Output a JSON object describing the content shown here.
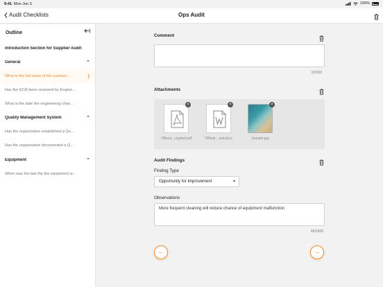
{
  "status_bar": {
    "time": "9:41",
    "date": "Mon Jun 3",
    "battery": "100%"
  },
  "navbar": {
    "back_label": "Audit Checklists",
    "title": "Ops Audit"
  },
  "sidebar": {
    "title": "Outline",
    "items": [
      {
        "label": "Introduction Section for Supplier Audit",
        "kind": "section"
      },
      {
        "label": "General",
        "kind": "section"
      },
      {
        "label": "What is the full name of the contract...",
        "kind": "question"
      },
      {
        "label": "Has the ECR been reviewed by Engine...",
        "kind": "question"
      },
      {
        "label": "What is the date the engineering chan...",
        "kind": "question"
      },
      {
        "label": "Quality Management System",
        "kind": "section"
      },
      {
        "label": "Has the organization established a Qu...",
        "kind": "question"
      },
      {
        "label": "Has the organization documented a Q...",
        "kind": "question"
      },
      {
        "label": "Equipment",
        "kind": "section"
      },
      {
        "label": "When was the last the the equipment w...",
        "kind": "question"
      }
    ]
  },
  "main": {
    "comment": {
      "label": "Comment",
      "value": "",
      "counter": "0/1500"
    },
    "attachments": {
      "label": "Attachments",
      "files": [
        {
          "name": "Official...crypted.pdf",
          "icon": "pdf-file-icon"
        },
        {
          "name": "Official....ord.docx",
          "icon": "word-file-icon"
        },
        {
          "name": "Sample.jpg",
          "icon": "image-thumbnail"
        }
      ]
    },
    "audit_findings": {
      "label": "Audit Findings",
      "finding_type_label": "Finding Type",
      "finding_type_value": "Opportunity for Improvement",
      "observations_label": "Observations",
      "observations_value": "More frequent cleaning will reduce chance of equipment malfunction",
      "observations_counter": "66/1500"
    },
    "nav": {
      "prev_icon": "arrow-left-icon",
      "next_icon": "arrow-right-icon"
    }
  },
  "colors": {
    "accent": "#f08c2e",
    "background": "#f2f2f2"
  }
}
